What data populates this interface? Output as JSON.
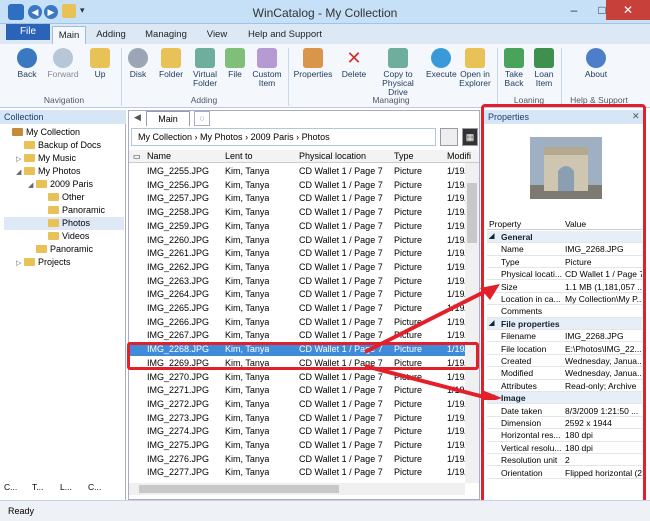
{
  "window": {
    "title": "WinCatalog - My Collection",
    "min": "–",
    "max": "□",
    "close": "✕"
  },
  "ribbon_tabs": [
    "File",
    "Main",
    "Adding",
    "Managing",
    "View",
    "Help and Support"
  ],
  "ribbon": {
    "navigation": {
      "label": "Navigation",
      "back": "Back",
      "forward": "Forward",
      "up": "Up"
    },
    "adding": {
      "label": "Adding",
      "disk": "Disk",
      "folder": "Folder",
      "virtual_folder": "Virtual Folder",
      "file": "File",
      "custom_item": "Custom Item"
    },
    "managing": {
      "label": "Managing",
      "properties": "Properties",
      "delete": "Delete",
      "copy": "Copy to Physical Drive",
      "execute": "Execute",
      "open": "Open in Explorer"
    },
    "loaning": {
      "label": "Loaning",
      "take_back": "Take Back",
      "loan_item": "Loan Item"
    },
    "help": {
      "label": "Help & Support",
      "about": "About"
    }
  },
  "collection": {
    "header": "Collection",
    "tree": [
      {
        "label": "My Collection",
        "depth": 0,
        "exp": ""
      },
      {
        "label": "Backup of Docs",
        "depth": 1,
        "exp": ""
      },
      {
        "label": "My Music",
        "depth": 1,
        "exp": "▷"
      },
      {
        "label": "My Photos",
        "depth": 1,
        "exp": "◢"
      },
      {
        "label": "2009 Paris",
        "depth": 2,
        "exp": "◢"
      },
      {
        "label": "Other",
        "depth": 3,
        "exp": ""
      },
      {
        "label": "Panoramic",
        "depth": 3,
        "exp": ""
      },
      {
        "label": "Photos",
        "depth": 3,
        "exp": ""
      },
      {
        "label": "Videos",
        "depth": 3,
        "exp": ""
      },
      {
        "label": "Panoramic",
        "depth": 2,
        "exp": ""
      },
      {
        "label": "Projects",
        "depth": 1,
        "exp": "▷"
      }
    ],
    "bottom_tabs": [
      "C...",
      "T...",
      "L...",
      "C..."
    ]
  },
  "center": {
    "tab": "Main",
    "breadcrumb": [
      "My Collection",
      "My Photos",
      "2009 Paris",
      "Photos"
    ],
    "columns": [
      "Name",
      "Lent to",
      "Physical location",
      "Type",
      "Modifi"
    ],
    "rows": [
      [
        "IMG_2255.JPG",
        "Kim, Tanya",
        "CD Wallet 1 / Page 7",
        "Picture",
        "1/19/2"
      ],
      [
        "IMG_2256.JPG",
        "Kim, Tanya",
        "CD Wallet 1 / Page 7",
        "Picture",
        "1/19/2"
      ],
      [
        "IMG_2257.JPG",
        "Kim, Tanya",
        "CD Wallet 1 / Page 7",
        "Picture",
        "1/19/2"
      ],
      [
        "IMG_2258.JPG",
        "Kim, Tanya",
        "CD Wallet 1 / Page 7",
        "Picture",
        "1/19/2"
      ],
      [
        "IMG_2259.JPG",
        "Kim, Tanya",
        "CD Wallet 1 / Page 7",
        "Picture",
        "1/19/2"
      ],
      [
        "IMG_2260.JPG",
        "Kim, Tanya",
        "CD Wallet 1 / Page 7",
        "Picture",
        "1/19/2"
      ],
      [
        "IMG_2261.JPG",
        "Kim, Tanya",
        "CD Wallet 1 / Page 7",
        "Picture",
        "1/19/2"
      ],
      [
        "IMG_2262.JPG",
        "Kim, Tanya",
        "CD Wallet 1 / Page 7",
        "Picture",
        "1/19/2"
      ],
      [
        "IMG_2263.JPG",
        "Kim, Tanya",
        "CD Wallet 1 / Page 7",
        "Picture",
        "1/19/2"
      ],
      [
        "IMG_2264.JPG",
        "Kim, Tanya",
        "CD Wallet 1 / Page 7",
        "Picture",
        "1/19/2"
      ],
      [
        "IMG_2265.JPG",
        "Kim, Tanya",
        "CD Wallet 1 / Page 7",
        "Picture",
        "1/19/2"
      ],
      [
        "IMG_2266.JPG",
        "Kim, Tanya",
        "CD Wallet 1 / Page 7",
        "Picture",
        "1/19/2"
      ],
      [
        "IMG_2267.JPG",
        "Kim, Tanya",
        "CD Wallet 1 / Page 7",
        "Picture",
        "1/19/2"
      ],
      [
        "IMG_2268.JPG",
        "Kim, Tanya",
        "CD Wallet 1 / Page 7",
        "Picture",
        "1/19/2"
      ],
      [
        "IMG_2269.JPG",
        "Kim, Tanya",
        "CD Wallet 1 / Page 7",
        "Picture",
        "1/19/2"
      ],
      [
        "IMG_2270.JPG",
        "Kim, Tanya",
        "CD Wallet 1 / Page 7",
        "Picture",
        "1/19/2"
      ],
      [
        "IMG_2271.JPG",
        "Kim, Tanya",
        "CD Wallet 1 / Page 7",
        "Picture",
        "1/19/2"
      ],
      [
        "IMG_2272.JPG",
        "Kim, Tanya",
        "CD Wallet 1 / Page 7",
        "Picture",
        "1/19/2"
      ],
      [
        "IMG_2273.JPG",
        "Kim, Tanya",
        "CD Wallet 1 / Page 7",
        "Picture",
        "1/19/2"
      ],
      [
        "IMG_2274.JPG",
        "Kim, Tanya",
        "CD Wallet 1 / Page 7",
        "Picture",
        "1/19/2"
      ],
      [
        "IMG_2275.JPG",
        "Kim, Tanya",
        "CD Wallet 1 / Page 7",
        "Picture",
        "1/19/2"
      ],
      [
        "IMG_2276.JPG",
        "Kim, Tanya",
        "CD Wallet 1 / Page 7",
        "Picture",
        "1/19/2"
      ],
      [
        "IMG_2277.JPG",
        "Kim, Tanya",
        "CD Wallet 1 / Page 7",
        "Picture",
        "1/19/2"
      ]
    ],
    "selected_index": 13
  },
  "properties": {
    "header": "Properties",
    "col_property": "Property",
    "col_value": "Value",
    "rows": [
      {
        "section": "General"
      },
      {
        "k": "Name",
        "v": "IMG_2268.JPG"
      },
      {
        "k": "Type",
        "v": "Picture"
      },
      {
        "k": "Physical locati...",
        "v": "CD Wallet 1 / Page 7"
      },
      {
        "k": "Size",
        "v": "1.1 MB (1,181,057 ..."
      },
      {
        "k": "Location in ca...",
        "v": "My Collection\\My P..."
      },
      {
        "k": "Comments",
        "v": ""
      },
      {
        "section": "File properties"
      },
      {
        "k": "Filename",
        "v": "IMG_2268.JPG"
      },
      {
        "k": "File location",
        "v": "E:\\Photos\\IMG_22..."
      },
      {
        "k": "Created",
        "v": "Wednesday, Janua..."
      },
      {
        "k": "Modified",
        "v": "Wednesday, Janua..."
      },
      {
        "k": "Attributes",
        "v": "Read-only; Archive"
      },
      {
        "section": "Image"
      },
      {
        "k": "Date taken",
        "v": "8/3/2009 1:21:50 ..."
      },
      {
        "k": "Dimension",
        "v": "2592 x 1944"
      },
      {
        "k": "Horizontal res...",
        "v": "180 dpi"
      },
      {
        "k": "Vertical resolu...",
        "v": "180 dpi"
      },
      {
        "k": "Resolution unit",
        "v": "2"
      },
      {
        "k": "Orientation",
        "v": "Flipped horizontal (2)"
      }
    ]
  },
  "status": "Ready",
  "colors": {
    "accent": "#3f8ad9",
    "highlight": "#e3202a",
    "file_tab": "#2a63b7"
  }
}
